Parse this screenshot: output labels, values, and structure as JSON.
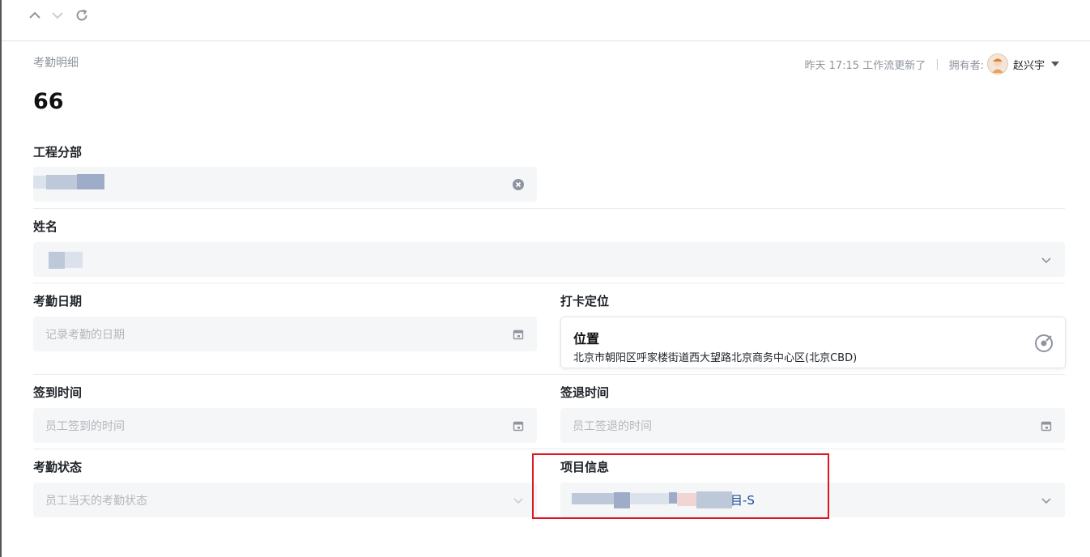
{
  "topbar": {
    "icons": [
      "chevron-up-icon",
      "chevron-down-icon",
      "refresh-icon"
    ]
  },
  "header": {
    "breadcrumb": "考勤明细",
    "update_info": "昨天 17:15 工作流更新了",
    "separator": "|",
    "owner_label": "拥有者:",
    "owner_name": "赵兴宇"
  },
  "record": {
    "title": "66"
  },
  "fields": {
    "division": {
      "label": "工程分部",
      "value": ""
    },
    "name": {
      "label": "姓名",
      "value": ""
    },
    "attendance_date": {
      "label": "考勤日期",
      "placeholder": "记录考勤的日期"
    },
    "checkin_location": {
      "label": "打卡定位",
      "title": "位置",
      "address": "北京市朝阳区呼家楼街道西大望路北京商务中心区(北京CBD)"
    },
    "signin_time": {
      "label": "签到时间",
      "placeholder": "员工签到的时间"
    },
    "signout_time": {
      "label": "签退时间",
      "placeholder": "员工签退的时间"
    },
    "attendance_status": {
      "label": "考勤状态",
      "placeholder": "员工当天的考勤状态"
    },
    "project_info": {
      "label": "项目信息",
      "value_visible_suffix": "目-S"
    }
  },
  "colors": {
    "highlight_box": "#e0141e",
    "field_bg": "#f5f6f7",
    "link_text": "#1e4b9b"
  }
}
